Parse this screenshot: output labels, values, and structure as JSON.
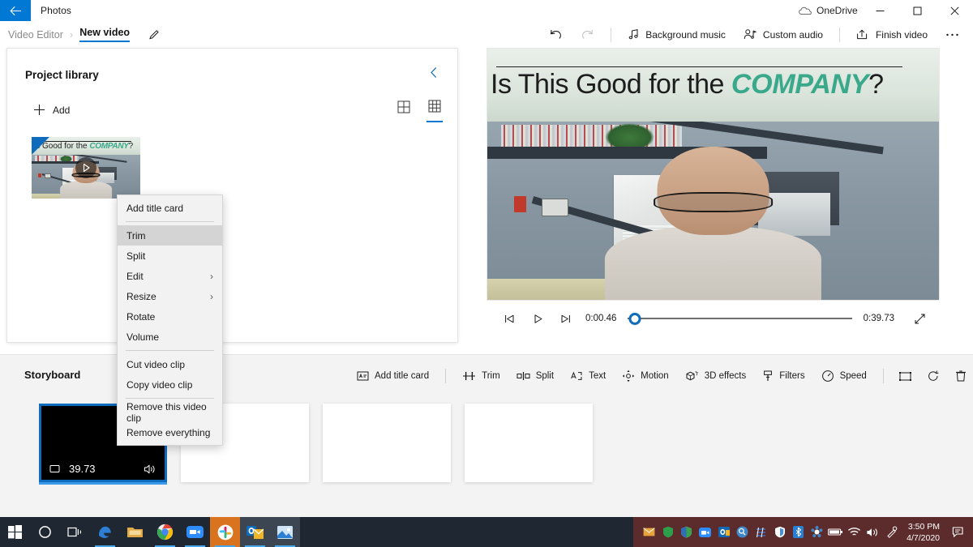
{
  "titlebar": {
    "back_icon": "back-arrow-icon",
    "app_title": "Photos",
    "onedrive_label": "OneDrive",
    "onedrive_icon": "cloud-icon",
    "minimize_icon": "minimize-icon",
    "maximize_icon": "maximize-icon",
    "close_icon": "close-icon"
  },
  "commandbar": {
    "breadcrumb_parent": "Video Editor",
    "breadcrumb_sep": "›",
    "breadcrumb_current": "New video",
    "rename_icon": "pencil-icon",
    "undo_icon": "undo-icon",
    "redo_icon": "redo-icon",
    "background_music": "Background music",
    "background_music_icon": "music-note-icon",
    "custom_audio": "Custom audio",
    "custom_audio_icon": "person-audio-icon",
    "finish_video": "Finish video",
    "finish_video_icon": "export-icon",
    "more_icon": "ellipsis-icon"
  },
  "library": {
    "title": "Project library",
    "collapse_icon": "chevron-left-icon",
    "add_label": "Add",
    "add_icon": "plus-icon",
    "view_large_icon": "grid-large-icon",
    "view_small_icon": "grid-small-icon",
    "active_view": "small",
    "items": [
      {
        "name": "video-thumbnail",
        "banner_pre": "is Good for the ",
        "banner_em": "COMPANY",
        "banner_post": "?",
        "play_icon": "play-icon",
        "selected": true
      }
    ]
  },
  "preview": {
    "banner_pre": "Is This Good for the ",
    "banner_em": "COMPANY",
    "banner_post": "?",
    "prev_frame_icon": "previous-frame-icon",
    "play_icon": "play-icon",
    "next_frame_icon": "next-frame-icon",
    "current_time": "0:00.46",
    "total_time": "0:39.73",
    "expand_icon": "fullscreen-icon",
    "progress_percent": 3
  },
  "storyboard": {
    "title": "Storyboard",
    "tools": [
      {
        "label": "Add title card",
        "icon": "title-card-icon"
      },
      {
        "label": "Trim",
        "icon": "trim-icon"
      },
      {
        "label": "Split",
        "icon": "split-icon"
      },
      {
        "label": "Text",
        "icon": "text-icon"
      },
      {
        "label": "Motion",
        "icon": "motion-icon"
      },
      {
        "label": "3D effects",
        "icon": "three-d-effects-icon"
      },
      {
        "label": "Filters",
        "icon": "filters-icon"
      },
      {
        "label": "Speed",
        "icon": "speed-icon"
      }
    ],
    "icon_tools": [
      {
        "name": "aspect-ratio-icon"
      },
      {
        "name": "rotate-icon"
      },
      {
        "name": "delete-icon"
      },
      {
        "name": "more-icon"
      }
    ],
    "clips": [
      {
        "duration": "39.73",
        "video_icon": "video-icon",
        "audio_icon": "speaker-icon",
        "selected": true
      },
      {
        "duration": "",
        "empty": true
      },
      {
        "duration": "",
        "empty": true
      },
      {
        "duration": "",
        "empty": true
      }
    ]
  },
  "context_menu": {
    "items": [
      {
        "label": "Add title card",
        "submenu": false,
        "highlighted": false
      },
      {
        "separator": true
      },
      {
        "label": "Trim",
        "submenu": false,
        "highlighted": true
      },
      {
        "label": "Split",
        "submenu": false,
        "highlighted": false
      },
      {
        "label": "Edit",
        "submenu": true,
        "highlighted": false
      },
      {
        "label": "Resize",
        "submenu": true,
        "highlighted": false
      },
      {
        "label": "Rotate",
        "submenu": false,
        "highlighted": false
      },
      {
        "label": "Volume",
        "submenu": false,
        "highlighted": false
      },
      {
        "separator": true
      },
      {
        "label": "Cut video clip",
        "submenu": false,
        "highlighted": false
      },
      {
        "label": "Copy video clip",
        "submenu": false,
        "highlighted": false
      },
      {
        "separator": true
      },
      {
        "label": "Remove this video clip",
        "submenu": false,
        "highlighted": false
      },
      {
        "label": "Remove everything",
        "submenu": false,
        "highlighted": false
      }
    ],
    "chevron": "›"
  },
  "taskbar": {
    "items": [
      {
        "name": "start-button-icon"
      },
      {
        "name": "cortana-icon"
      },
      {
        "name": "task-view-icon"
      },
      {
        "name": "edge-icon"
      },
      {
        "name": "file-explorer-icon"
      },
      {
        "name": "chrome-icon"
      },
      {
        "name": "zoom-icon"
      },
      {
        "name": "slack-icon"
      },
      {
        "name": "outlook-icon"
      },
      {
        "name": "photos-icon"
      }
    ],
    "tray_icons": [
      "mail-tray-icon",
      "shield-green-icon",
      "security-icon",
      "zoom-tray-icon",
      "outlook-tray-icon",
      "search-tray-icon",
      "sync-icon",
      "defender-icon",
      "bluetooth-icon",
      "settings-tray-icon",
      "battery-icon",
      "wifi-icon",
      "volume-icon",
      "pen-icon"
    ],
    "time": "3:50 PM",
    "date": "4/7/2020",
    "action_center_icon": "action-center-icon"
  },
  "colors": {
    "accent": "#0078d4",
    "accent_dark": "#0f6cbd",
    "taskbar_bg": "#1f2733",
    "tray_bg": "#5c2b2b",
    "storyboard_bg": "#f3f3f3",
    "menu_bg": "#f2f2f2",
    "company_teal": "#3aa88a"
  }
}
